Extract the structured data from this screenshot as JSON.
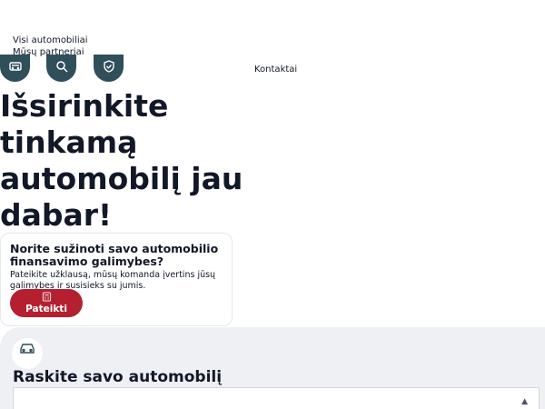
{
  "nav": {
    "links": [
      "Visi automobiliai",
      "Mūsų partneriai"
    ],
    "contact": "Kontaktai"
  },
  "icons": [
    "car-icon",
    "search-car-icon",
    "shield-check-icon"
  ],
  "hero": {
    "title": "Išsirinkite tinkamą automobilį jau dabar!"
  },
  "finance_card": {
    "title": "Norite sužinoti savo automobilio finansavimo galimybes?",
    "description": "Pateikite užklausą, mūsų komanda įvertins jūsų galimybes ir susisieks su jumis.",
    "button_label": "Pateikti",
    "button_icon": "calculator-icon"
  },
  "search": {
    "icon": "car-icon",
    "title": "Raskite savo automobilį",
    "select_value": "",
    "caret_icon": "chevron-up-icon"
  },
  "colors": {
    "icon_bg": "#2f4f5a",
    "accent": "#b4202f",
    "section_bg": "#eef0f3"
  }
}
